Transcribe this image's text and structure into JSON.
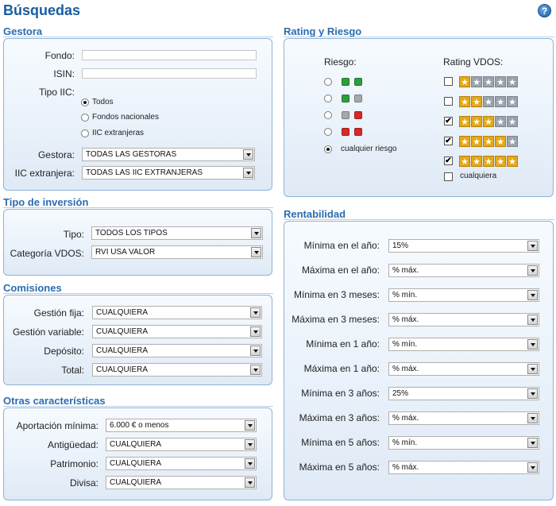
{
  "page": {
    "title": "Búsquedas",
    "help_icon": "?"
  },
  "gestora": {
    "title": "Gestora",
    "fondo_label": "Fondo:",
    "isin_label": "ISIN:",
    "tipo_iic_label": "Tipo IIC:",
    "tipo_iic_options": [
      "Todos",
      "Fondos nacionales",
      "IIC extranjeras"
    ],
    "gestora_label": "Gestora:",
    "gestora_value": "TODAS LAS GESTORAS",
    "iic_extranjera_label": "IIC extranjera:",
    "iic_extranjera_value": "TODAS LAS IIC EXTRANJERAS"
  },
  "tipo_inversion": {
    "title": "Tipo de inversión",
    "tipo_label": "Tipo:",
    "tipo_value": "TODOS LOS TIPOS",
    "categoria_label": "Categoría VDOS:",
    "categoria_value": "RVI USA VALOR"
  },
  "comisiones": {
    "title": "Comisiones",
    "rows": [
      {
        "label": "Gestión fija:",
        "value": "CUALQUIERA"
      },
      {
        "label": "Gestión variable:",
        "value": "CUALQUIERA"
      },
      {
        "label": "Depósito:",
        "value": "CUALQUIERA"
      },
      {
        "label": "Total:",
        "value": "CUALQUIERA"
      }
    ]
  },
  "otras": {
    "title": "Otras características",
    "rows": [
      {
        "label": "Aportación mínima:",
        "value": "6.000 € o menos"
      },
      {
        "label": "Antigüedad:",
        "value": "CUALQUIERA"
      },
      {
        "label": "Patrimonio:",
        "value": "CUALQUIERA"
      },
      {
        "label": "Divisa:",
        "value": "CUALQUIERA"
      }
    ]
  },
  "rating": {
    "title": "Rating y Riesgo",
    "riesgo_label": "Riesgo:",
    "rating_label": "Rating VDOS:",
    "riesgo_any_label": "cualquier riesgo",
    "rating_any_label": "cualquiera",
    "riesgo_options": [
      {
        "colors": [
          "#2e9e3a",
          "#2e9e3a"
        ]
      },
      {
        "colors": [
          "#2e9e3a",
          "#a8a8a8"
        ]
      },
      {
        "colors": [
          "#a8a8a8",
          "#d62a2a"
        ]
      },
      {
        "colors": [
          "#d62a2a",
          "#d62a2a"
        ]
      }
    ],
    "rating_rows": [
      {
        "stars": 1,
        "checked": false
      },
      {
        "stars": 2,
        "checked": false
      },
      {
        "stars": 3,
        "checked": true
      },
      {
        "stars": 4,
        "checked": true
      },
      {
        "stars": 5,
        "checked": true
      }
    ],
    "check_glyph": "✔",
    "star_glyph": "★"
  },
  "rentabilidad": {
    "title": "Rentabilidad",
    "rows": [
      {
        "label": "Mínima en el año:",
        "value": "15%"
      },
      {
        "label": "Máxima en el año:",
        "value": "% máx."
      },
      {
        "label": "Mínima en 3 meses:",
        "value": "% mín."
      },
      {
        "label": "Máxima en 3 meses:",
        "value": "% máx."
      },
      {
        "label": "Mínima en 1 año:",
        "value": "% mín."
      },
      {
        "label": "Máxima en 1 año:",
        "value": "% máx."
      },
      {
        "label": "Mínima en 3 años:",
        "value": "25%"
      },
      {
        "label": "Máxima en 3 años:",
        "value": "% máx."
      },
      {
        "label": "Mínima en 5 años:",
        "value": "% mín."
      },
      {
        "label": "Máxima en 5 años:",
        "value": "% máx."
      }
    ]
  }
}
